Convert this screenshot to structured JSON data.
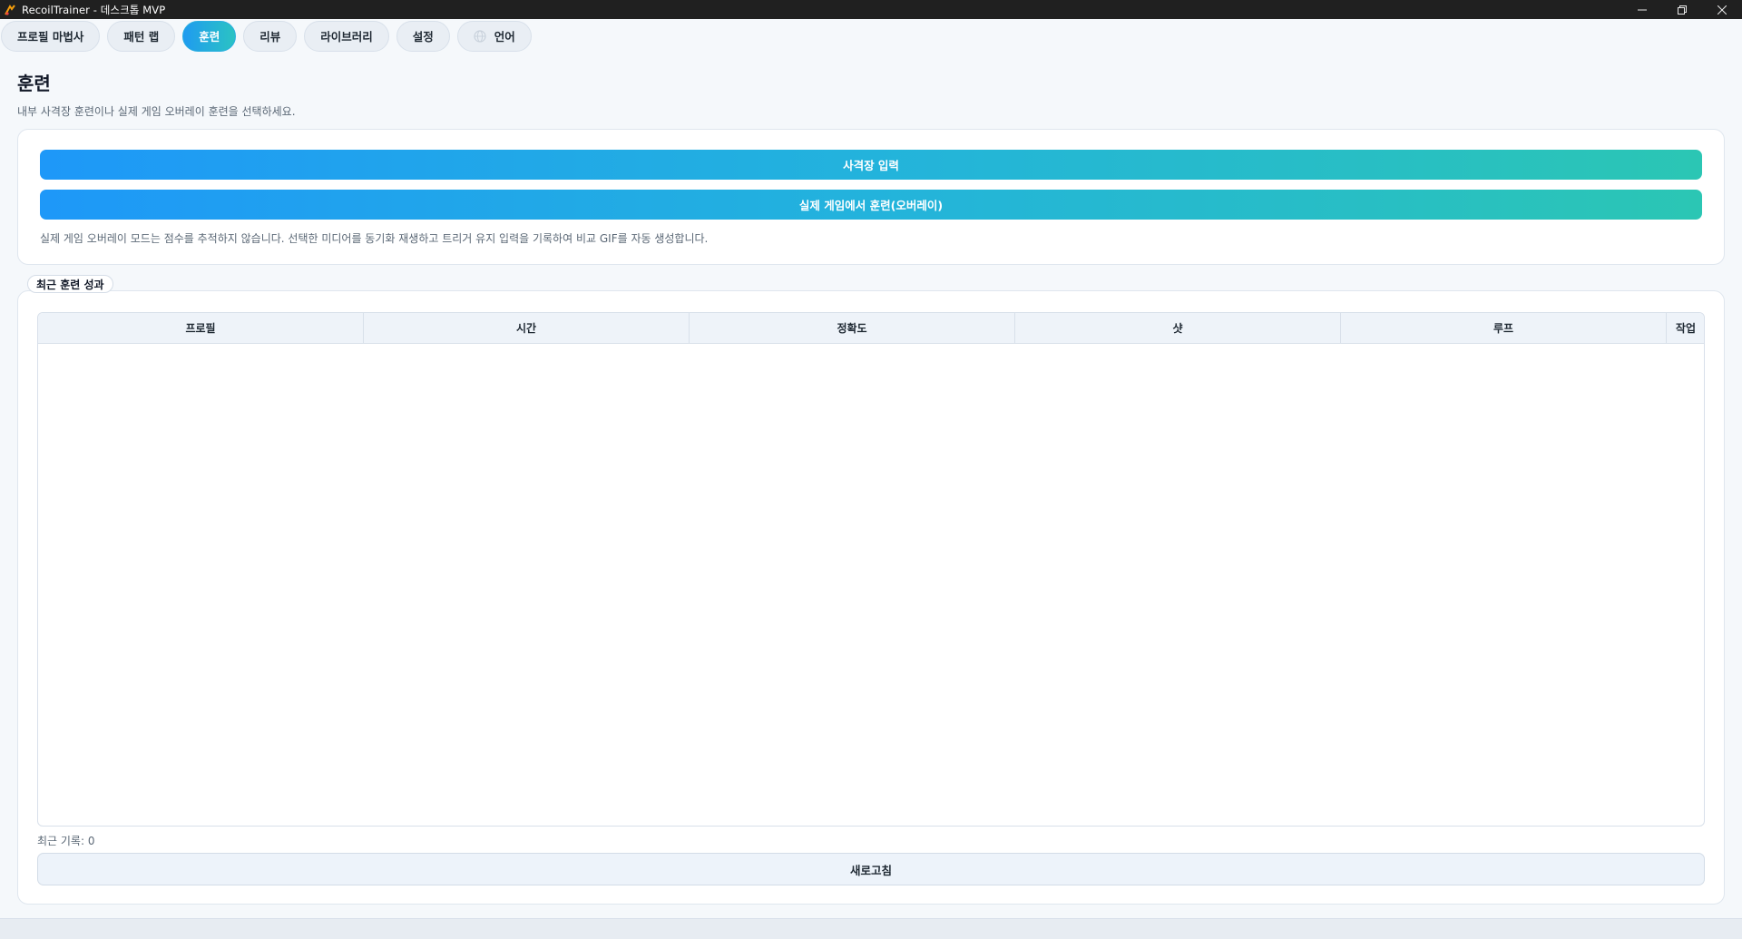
{
  "window": {
    "title": "RecoilTrainer - 데스크톱 MVP",
    "icon": "app-logo-icon",
    "controls": [
      "minimize-icon",
      "restore-icon",
      "close-icon"
    ]
  },
  "tabs": [
    {
      "label": "프로필 마법사",
      "active": false
    },
    {
      "label": "패턴 랩",
      "active": false
    },
    {
      "label": "훈련",
      "active": true
    },
    {
      "label": "리뷰",
      "active": false
    },
    {
      "label": "라이브러리",
      "active": false
    },
    {
      "label": "설정",
      "active": false
    },
    {
      "label": "언어",
      "active": false,
      "icon": "globe-icon"
    }
  ],
  "page": {
    "title": "훈련",
    "subtitle": "내부 사격장 훈련이나 실제 게임 오버레이 훈련을 선택하세요."
  },
  "training": {
    "range_button": "사격장 입력",
    "overlay_button": "실제 게임에서 훈련(오버레이)",
    "note": "실제 게임 오버레이 모드는 점수를 추적하지 않습니다. 선택한 미디어를 동기화 재생하고 트리거 유지 입력을 기록하여 비교 GIF를 자동 생성합니다."
  },
  "results": {
    "legend": "최근 훈련 성과",
    "columns": [
      "프로필",
      "시간",
      "정확도",
      "샷",
      "루프",
      "작업"
    ],
    "rows": [],
    "record_count": "최근 기록: 0",
    "refresh_button": "새로고침"
  },
  "colors": {
    "accent_start": "#1e98f8",
    "accent_end": "#2bc6b4",
    "titlebar": "#202020",
    "background": "#f5f8fb"
  }
}
